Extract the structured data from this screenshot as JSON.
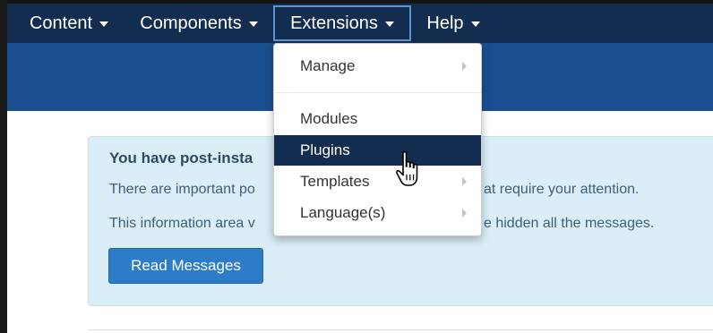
{
  "navbar": {
    "items": [
      {
        "label": "Content"
      },
      {
        "label": "Components"
      },
      {
        "label": "Extensions"
      },
      {
        "label": "Help"
      }
    ]
  },
  "dropdown": {
    "items": [
      {
        "label": "Manage",
        "has_submenu": true
      },
      {
        "label": "Modules",
        "has_submenu": false
      },
      {
        "label": "Plugins",
        "has_submenu": false,
        "highlighted": true
      },
      {
        "label": "Templates",
        "has_submenu": true
      },
      {
        "label": "Language(s)",
        "has_submenu": true
      }
    ]
  },
  "alert": {
    "title": "You have post-insta",
    "line1_start": "There are important po",
    "line1_end": "at require your attention.",
    "line2_start": "This information area v",
    "line2_end": "e hidden all the messages.",
    "button_label": "Read Messages"
  },
  "colors": {
    "navbar_bg": "#132d50",
    "subheader_bg": "#1a4f8f",
    "alert_bg": "#dbeef7",
    "button_bg": "#2d7cc7",
    "highlight_bg": "#132d50"
  },
  "cursor_icon": "hand-pointer-icon"
}
